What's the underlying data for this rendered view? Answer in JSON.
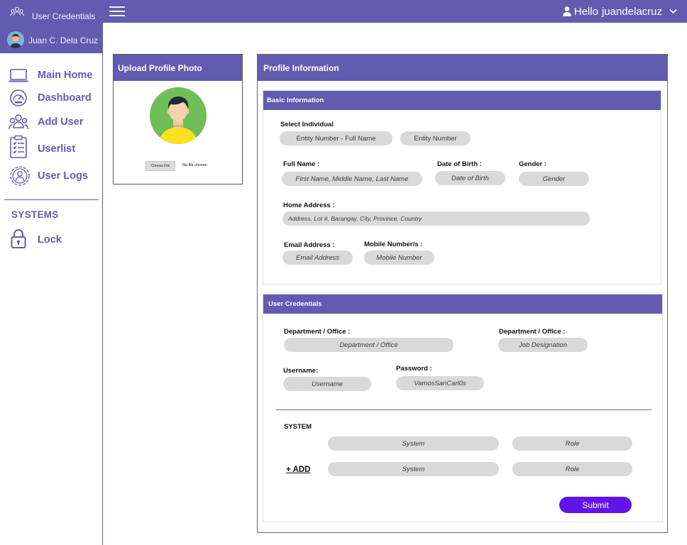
{
  "topbar": {
    "brand_label": "User Credentials",
    "greeting": "Hello",
    "username": "juandelacruz"
  },
  "sidebar": {
    "profile_name": "Juan C. Dela Cruz",
    "items": [
      {
        "label": "Main Home",
        "icon": "laptop-icon"
      },
      {
        "label": "Dashboard",
        "icon": "gauge-icon"
      },
      {
        "label": "Add User",
        "icon": "users-icon"
      },
      {
        "label": "Userlist",
        "icon": "clipboard-icon"
      },
      {
        "label": "User Logs",
        "icon": "user-gear-icon"
      }
    ],
    "systems_heading": "SYSTEMS",
    "lock_label": "Lock"
  },
  "upload": {
    "title": "Upload Profile Photo",
    "choose_file": "Choose File",
    "file_status": "No file chosen"
  },
  "profile": {
    "title": "Profile Information",
    "basic": {
      "title": "Basic Information",
      "select_individual_label": "Select Individual",
      "entity_full_placeholder": "Entity Number - Full Name",
      "entity_number_placeholder": "Entity Number",
      "full_name_label": "Full Name :",
      "full_name_placeholder": "First Name, Middle Name, Last Name",
      "dob_label": "Date of Birth :",
      "dob_placeholder": "Date of Birth",
      "gender_label": "Gender :",
      "gender_placeholder": "Gender",
      "address_label": "Home Address :",
      "address_placeholder": "Address, Lot #, Barangay, City, Province, Country",
      "email_label": "Email Address :",
      "email_placeholder": "Email Address",
      "mobile_label": "Mobile Number/s :",
      "mobile_placeholder": "Mobile Number"
    },
    "credentials": {
      "title": "User Credentials",
      "department_label": "Department  / Office :",
      "department_placeholder": "Department / Office",
      "job_label": "Department  / Office :",
      "job_placeholder": "Job Designation",
      "username_label": "Username:",
      "username_placeholder": "Username",
      "password_label": "Password :",
      "password_value": "VamosSanCarl0s",
      "system_heading": "SYSTEM",
      "system_placeholder": "System",
      "role_placeholder": "Role",
      "add_label": "+ ADD",
      "submit_label": "Submit"
    }
  },
  "colors": {
    "accent": "#625bb0",
    "submit": "#6213ea",
    "field": "#d9d9d9"
  }
}
